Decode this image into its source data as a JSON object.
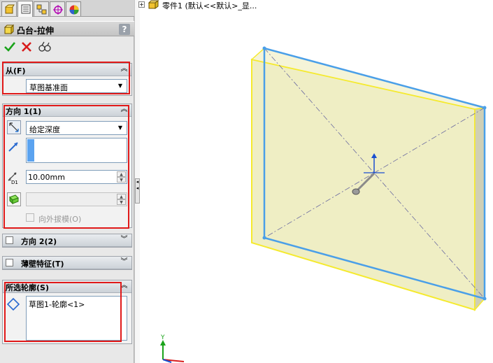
{
  "colors": {
    "panel_bg": "#e8e8e8",
    "group_header": "#d7dce1",
    "highlight_red": "#e01919",
    "part_face": "#efeec4",
    "part_edge_yellow": "#f5ea2e",
    "part_edge_blue": "#4a9fe8"
  },
  "tabs": [
    {
      "icon": "feature-manager-icon"
    },
    {
      "icon": "property-manager-icon"
    },
    {
      "icon": "configuration-manager-icon"
    },
    {
      "icon": "dimxpert-icon"
    },
    {
      "icon": "display-manager-icon"
    }
  ],
  "feature": {
    "title": "凸台-拉伸",
    "help": "?"
  },
  "actions": {
    "ok": "ok-check-icon",
    "cancel": "cancel-x-icon",
    "preview": "detailed-preview-icon"
  },
  "from_group": {
    "label": "从(F)",
    "start_condition": "草图基准面"
  },
  "direction1": {
    "label": "方向 1(1)",
    "end_condition": "给定深度",
    "depth": "10.00mm",
    "draft_outward": "向外拔模(O)"
  },
  "direction2": {
    "label": "方向 2(2)"
  },
  "thin_feature": {
    "label": "薄壁特征(T)"
  },
  "selected_contours": {
    "label": "所选轮廓(S)",
    "items": [
      "草图1-轮廓<1>"
    ]
  },
  "tree": {
    "expand": "+",
    "part_label": "零件1  (默认<<默认>_显..."
  },
  "triad": {
    "y_label": "Y"
  }
}
